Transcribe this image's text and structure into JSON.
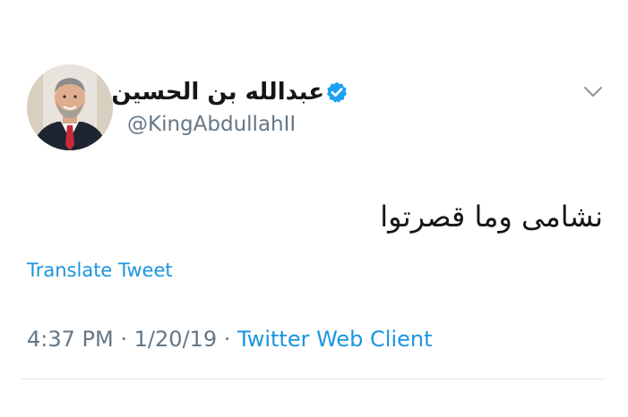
{
  "tweet": {
    "author": {
      "display_name": "عبدالله بن الحسين",
      "handle": "@KingAbdullahII",
      "verified": true
    },
    "text": "نشامى وما قصرتوا",
    "translate_label": "Translate Tweet",
    "time": "4:37 PM",
    "separator": " · ",
    "date": "1/20/19",
    "source": "Twitter Web Client"
  },
  "colors": {
    "link": "#1b95e0",
    "secondary_text": "#657786",
    "primary_text": "#14171a",
    "verified_badge": "#1da1f2",
    "divider": "#e1e8ed"
  },
  "icons": {
    "verified": "verified-badge-icon",
    "menu": "chevron-down-icon"
  }
}
